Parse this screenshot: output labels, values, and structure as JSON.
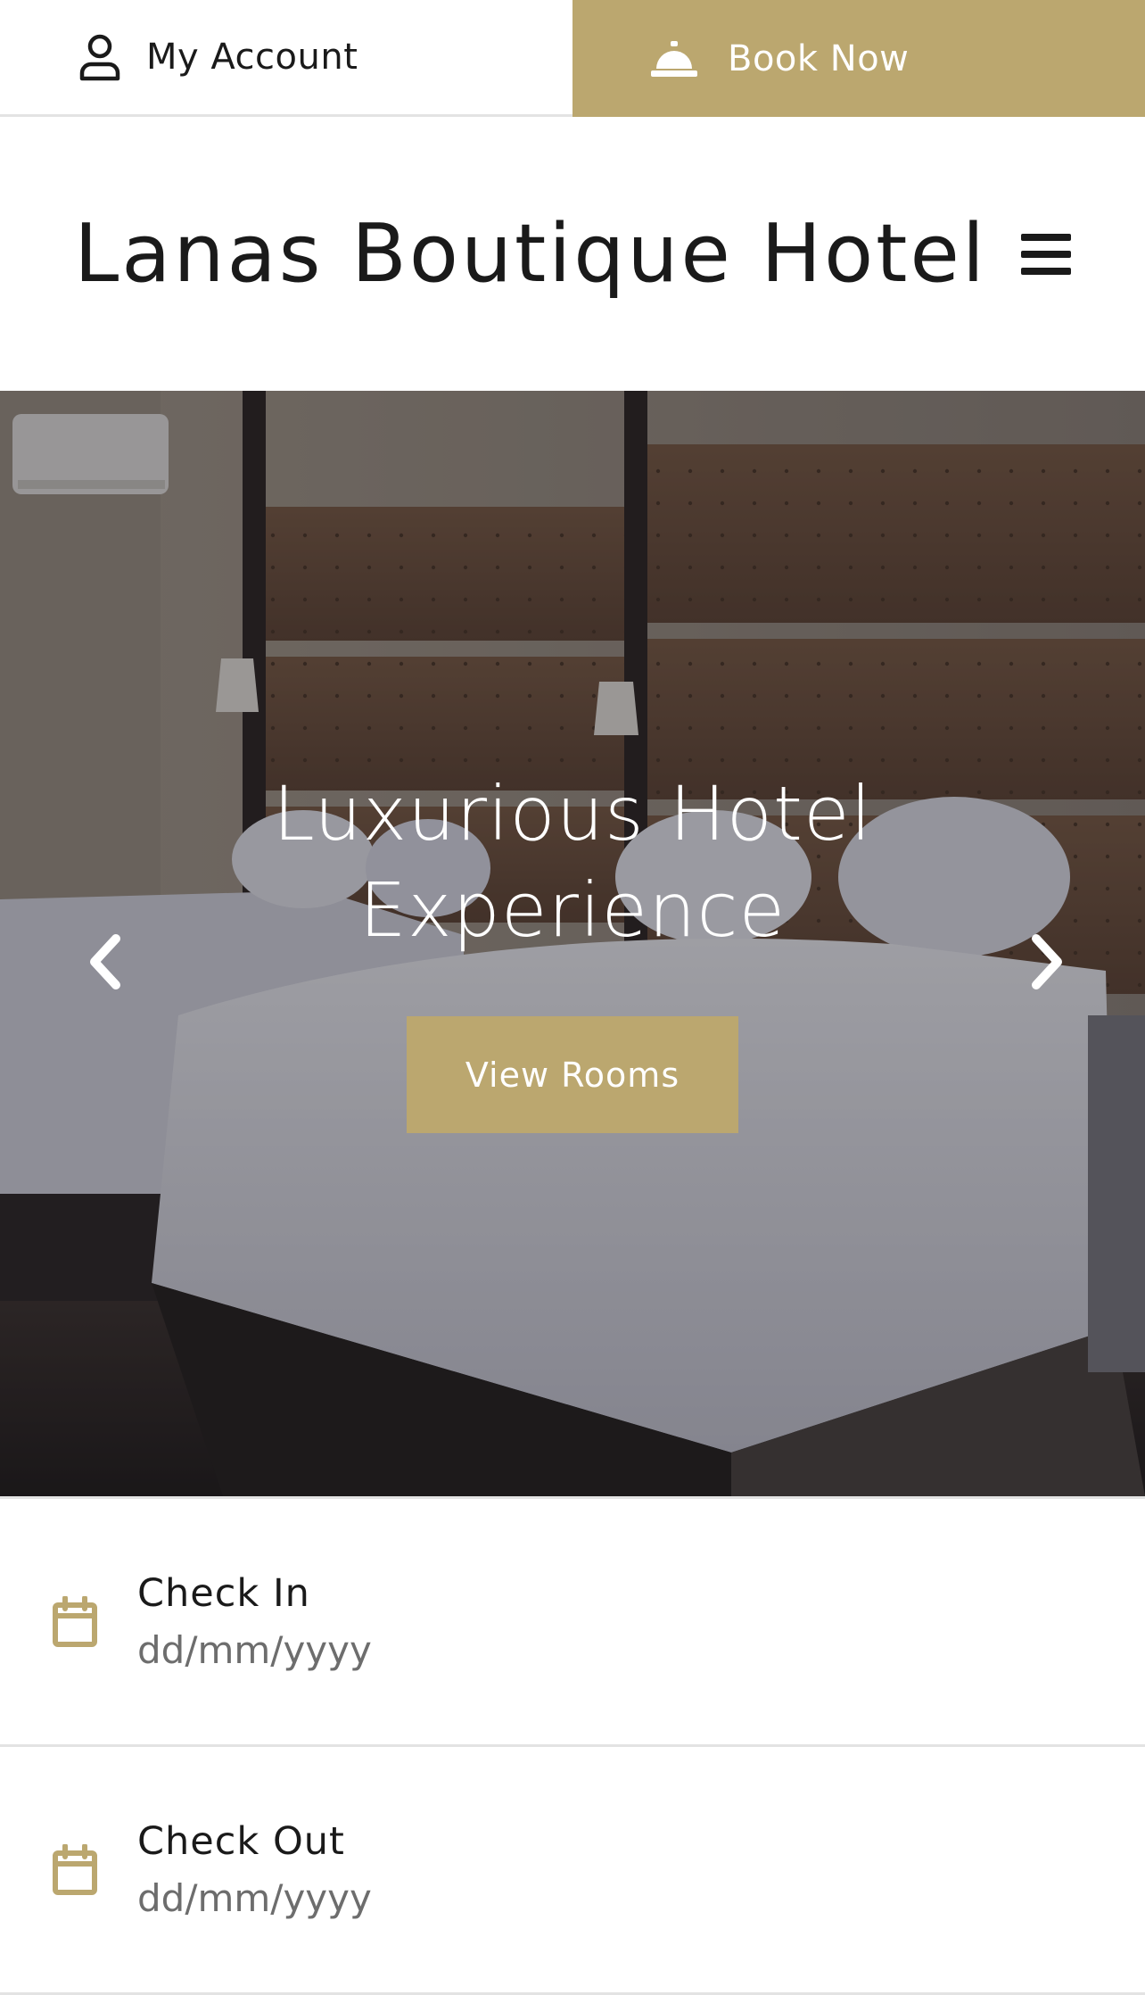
{
  "topbar": {
    "account_label": "My Account",
    "book_label": "Book Now",
    "accent_color": "#bba76f"
  },
  "header": {
    "title": "Lanas Boutique Hotel"
  },
  "hero": {
    "title_line1": "Luxurious Hotel",
    "title_line2": "Experience",
    "cta_label": "View Rooms"
  },
  "booking": {
    "check_in": {
      "label": "Check In",
      "placeholder": "dd/mm/yyyy"
    },
    "check_out": {
      "label": "Check Out",
      "placeholder": "dd/mm/yyyy"
    }
  },
  "icons": {
    "account": "user-icon",
    "book": "bell-icon",
    "menu": "hamburger-menu-icon",
    "prev": "chevron-left-icon",
    "next": "chevron-right-icon",
    "calendar": "calendar-icon"
  }
}
